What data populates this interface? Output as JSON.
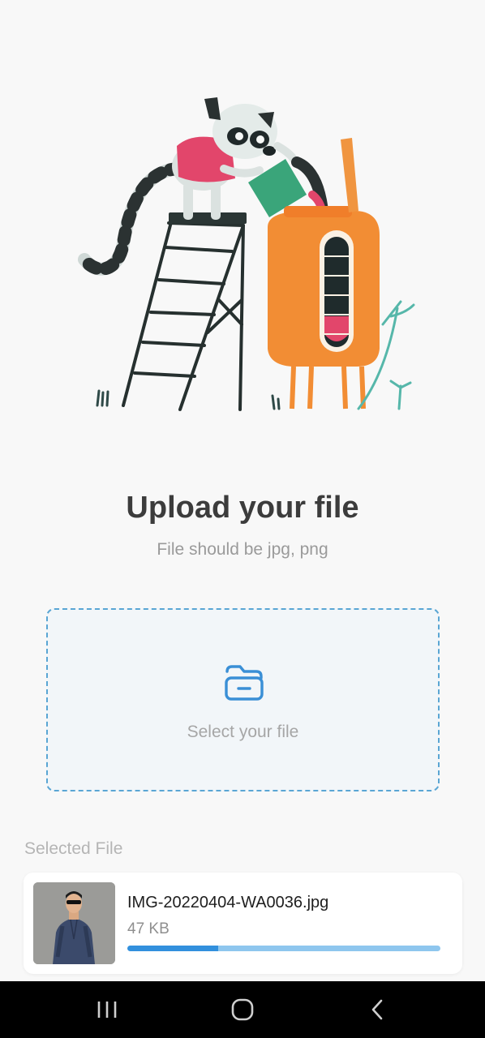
{
  "header": {
    "title": "Upload your file",
    "subtitle": "File should be jpg, png"
  },
  "dropzone": {
    "label": "Select your file",
    "icon": "folder-icon"
  },
  "selected": {
    "section_label": "Selected File",
    "file": {
      "name": "IMG-20220404-WA0036.jpg",
      "size": "47 KB",
      "progress": 0.29
    }
  },
  "nav": {
    "icons": [
      "recent-apps-icon",
      "home-icon",
      "back-icon"
    ]
  },
  "colors": {
    "accent": "#3290dd",
    "accent_light": "#8ec6ee",
    "dropzone_border": "#5aa6d4"
  }
}
